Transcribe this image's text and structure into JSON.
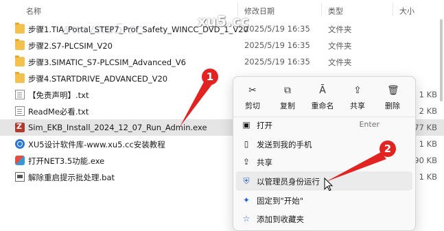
{
  "columns": {
    "name": "名称",
    "date": "修改日期",
    "type": "类型",
    "size": "大小"
  },
  "files": [
    {
      "name": "步骤1.TIA_Portal_STEP7_Prof_Safety_WINCC_DVD_1_V20",
      "date": "2025/5/19 16:35",
      "type": "文件夹",
      "size": "",
      "icon": "folder-icon"
    },
    {
      "name": "步骤2.S7-PLCSIM_V20",
      "date": "2025/5/19 16:35",
      "type": "文件夹",
      "size": "",
      "icon": "folder-icon"
    },
    {
      "name": "步骤3.SIMATIC_S7-PLCSIM_Advanced_V6",
      "date": "2025/5/19 16:35",
      "type": "文件夹",
      "size": "",
      "icon": "folder-icon"
    },
    {
      "name": "步骤4.STARTDRIVE_ADVANCED_V20",
      "date": "",
      "type": "",
      "size": "",
      "icon": "folder-icon"
    },
    {
      "name": "【免责声明】.txt",
      "date": "",
      "type": "",
      "size": "1 KB",
      "icon": "text-file-icon"
    },
    {
      "name": "ReadMe必看.txt",
      "date": "",
      "type": "",
      "size": "2 KB",
      "icon": "text-file-icon"
    },
    {
      "name": "Sim_EKB_Install_2024_12_07_Run_Admin.exe",
      "date": "",
      "type": "",
      "size": "277 KB",
      "icon": "exe-icon"
    },
    {
      "name": "XU5设计软件库-www.xu5.cc安装教程",
      "date": "",
      "type": "",
      "size": "1 KB",
      "icon": "web-shortcut-icon"
    },
    {
      "name": "打开NET3.5功能.exe",
      "date": "",
      "type": "",
      "size": "190 KB",
      "icon": "app-icon"
    },
    {
      "name": "解除重启提示批处理.bat",
      "date": "",
      "type": "",
      "size": "1 KB",
      "icon": "batch-file-icon"
    }
  ],
  "watermark": "xu5.cc",
  "watermark_faint": "www.xu5.cc",
  "quick_actions": [
    {
      "label": "剪切",
      "icon": "cut-icon",
      "glyph": "✂"
    },
    {
      "label": "复制",
      "icon": "copy-icon",
      "glyph": "⧉"
    },
    {
      "label": "重命名",
      "icon": "rename-icon",
      "glyph": "Ā"
    },
    {
      "label": "共享",
      "icon": "share-icon",
      "glyph": "⇪"
    },
    {
      "label": "删除",
      "icon": "delete-icon",
      "glyph": "🗑"
    }
  ],
  "menu_items": [
    {
      "label": "打开",
      "shortcut": "Enter",
      "icon": "open-icon",
      "glyph": "▣"
    },
    {
      "label": "发送到我的手机",
      "shortcut": "",
      "icon": "phone-icon",
      "glyph": "▯"
    },
    {
      "label": "共享",
      "shortcut": "",
      "icon": "share-icon",
      "glyph": "⇪"
    },
    {
      "label": "以管理员身份运行",
      "shortcut": "",
      "icon": "admin-shield-icon",
      "glyph": "⛨"
    },
    {
      "label": "固定到\"开始\"",
      "shortcut": "",
      "icon": "pin-icon",
      "glyph": "✦"
    },
    {
      "label": "添加到收藏夹",
      "shortcut": "",
      "icon": "star-icon",
      "glyph": "☆"
    }
  ],
  "annotations": [
    {
      "number": "1"
    },
    {
      "number": "2"
    }
  ],
  "colors": {
    "annotation": "#e32222",
    "folder": "#f2c14e",
    "selection": "#e5e5e5"
  }
}
